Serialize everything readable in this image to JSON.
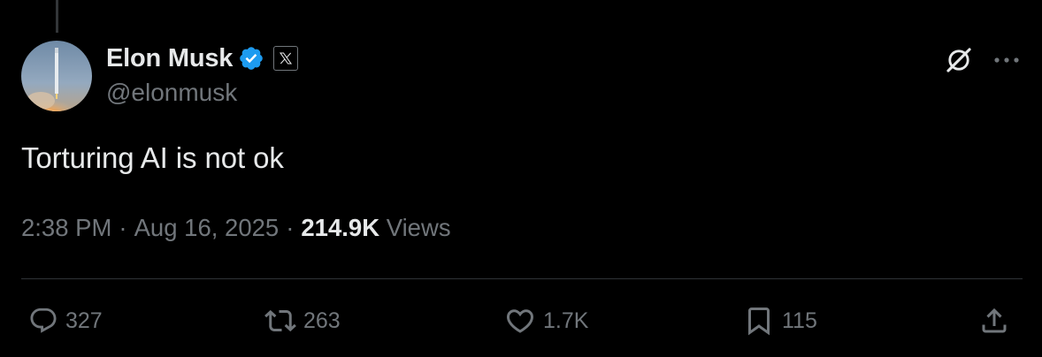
{
  "author": {
    "display_name": "Elon Musk",
    "handle": "@elonmusk",
    "verified": true,
    "affiliate_badge": "X"
  },
  "tweet": {
    "text": "Torturing AI is not ok",
    "time": "2:38 PM",
    "date": "Aug 16, 2025",
    "separator": "·",
    "views_count": "214.9K",
    "views_label": "Views"
  },
  "actions": {
    "replies": "327",
    "reposts": "263",
    "likes": "1.7K",
    "bookmarks": "115"
  },
  "icons": {
    "verified": "verified-badge-icon",
    "affiliate": "x-logo-icon",
    "grok": "grok-icon",
    "more": "more-dots-icon",
    "reply": "reply-bubble-icon",
    "repost": "repost-arrows-icon",
    "like": "heart-icon",
    "bookmark": "bookmark-icon",
    "share": "share-upload-icon"
  },
  "colors": {
    "background": "#000000",
    "text_primary": "#e7e9ea",
    "text_secondary": "#71767b",
    "verified_blue": "#1d9bf0",
    "divider": "#2f3336"
  }
}
